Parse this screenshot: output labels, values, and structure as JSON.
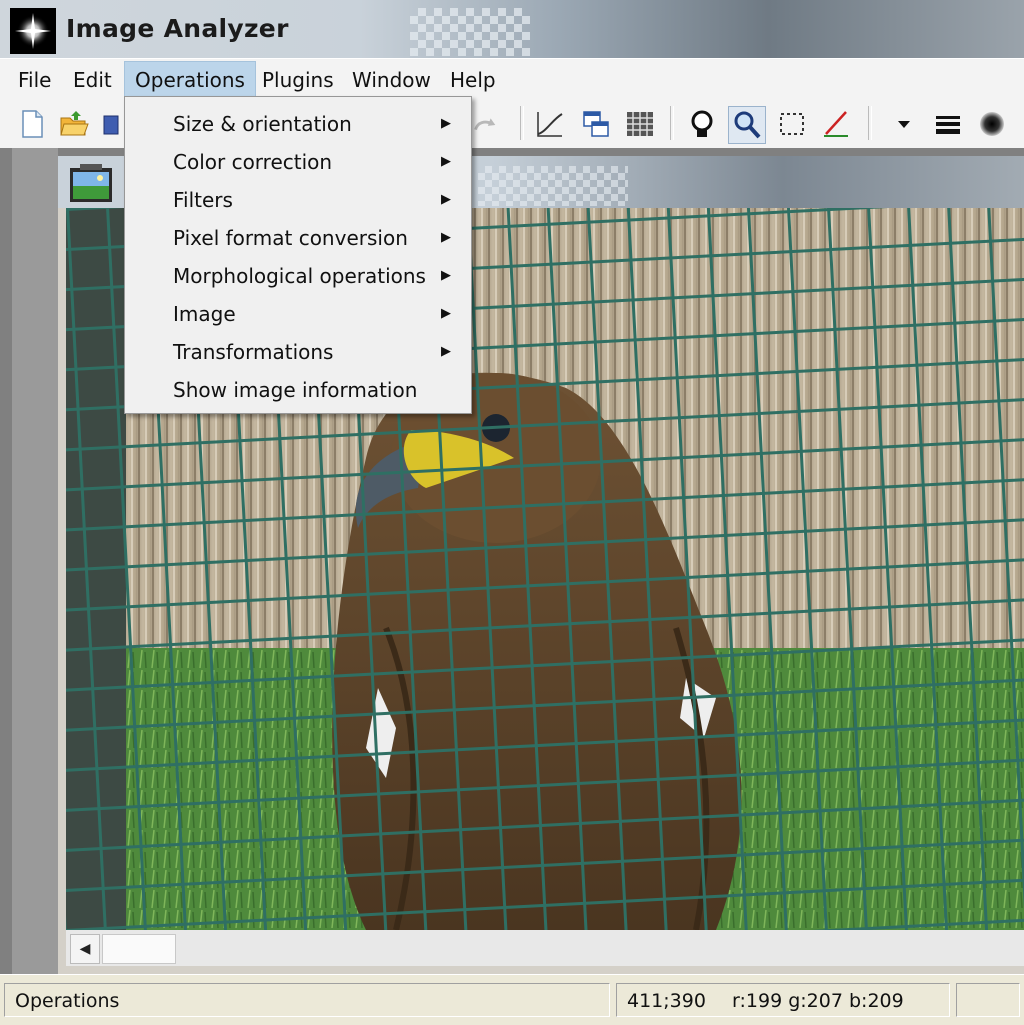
{
  "window": {
    "title": "Image Analyzer",
    "app_icon": "starburst-icon"
  },
  "menubar": {
    "items": [
      {
        "label": "File"
      },
      {
        "label": "Edit"
      },
      {
        "label": "Operations",
        "active": true
      },
      {
        "label": "Plugins"
      },
      {
        "label": "Window"
      },
      {
        "label": "Help"
      }
    ]
  },
  "toolbar": {
    "buttons": [
      "new-document-icon",
      "open-folder-icon",
      "save-icon",
      "redo-icon",
      "curve-icon",
      "copy-window-icon",
      "grid-icon",
      "lamp-icon",
      "zoom-icon",
      "selection-icon",
      "line-tool-icon",
      "dropdown-arrow-icon",
      "line-width-icon",
      "brush-icon"
    ],
    "pressed": "zoom-icon"
  },
  "operations_menu": {
    "items": [
      {
        "label": "Size & orientation",
        "submenu": true
      },
      {
        "label": "Color correction",
        "submenu": true
      },
      {
        "label": "Filters",
        "submenu": true
      },
      {
        "label": "Pixel format conversion",
        "submenu": true
      },
      {
        "label": "Morphological operations",
        "submenu": true
      },
      {
        "label": "Image",
        "submenu": true
      },
      {
        "label": "Transformations",
        "submenu": true
      },
      {
        "label": "Show image information",
        "submenu": false
      }
    ],
    "submenu_arrow": "▶"
  },
  "child_window": {
    "icon": "landscape-image-icon",
    "scroll_left": "◀"
  },
  "statusbar": {
    "message": "Operations",
    "coords": "411;390",
    "color": "r:199 g:207 b:209"
  },
  "colors": {
    "menu_highlight": "#bcd5ea",
    "fence_green": "#2f6f63",
    "grass": "#4f8a3c"
  }
}
